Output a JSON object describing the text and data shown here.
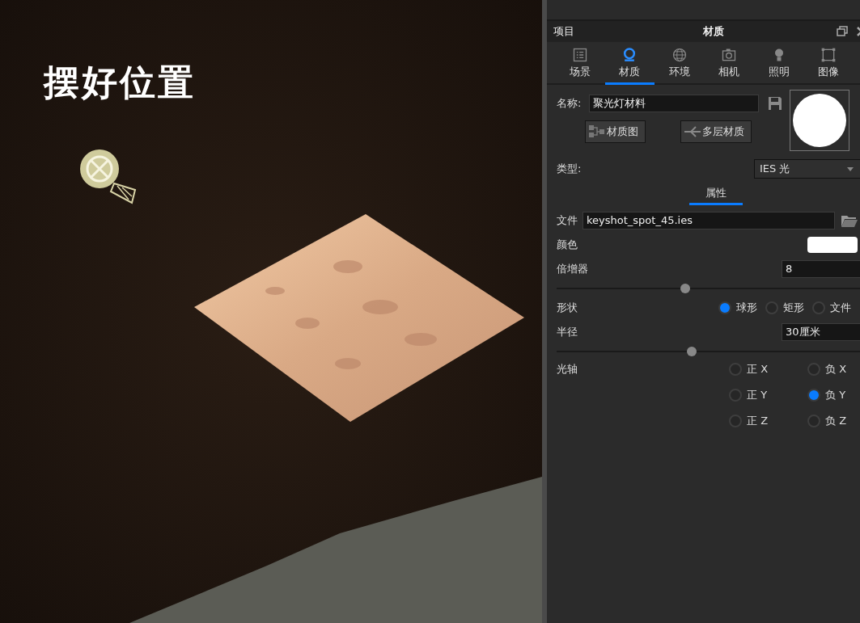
{
  "viewport": {
    "caption": "摆好位置"
  },
  "panel": {
    "project_label": "项目",
    "title": "材质",
    "tabs": [
      {
        "label": "场景",
        "selected": false
      },
      {
        "label": "材质",
        "selected": true
      },
      {
        "label": "环境",
        "selected": false
      },
      {
        "label": "相机",
        "selected": false
      },
      {
        "label": "照明",
        "selected": false
      },
      {
        "label": "图像",
        "selected": false
      }
    ],
    "name_label": "名称:",
    "name_value": "聚光灯材料",
    "buttons": [
      "材质图",
      "多层材质"
    ],
    "type_label": "类型:",
    "type_value": "IES 光",
    "section_tabs": [
      {
        "label": "属性",
        "selected": true
      }
    ],
    "properties": [
      {
        "kind": "file",
        "label": "文件",
        "value": "keyshot_spot_45.ies"
      },
      {
        "kind": "color",
        "label": "颜色",
        "color": "#ffffff"
      },
      {
        "kind": "number",
        "label": "倍增器",
        "value": "8",
        "level": 0.41
      },
      {
        "kind": "radio",
        "label": "形状",
        "options": [
          {
            "label": "球形",
            "selected": true
          },
          {
            "label": "矩形",
            "selected": false
          },
          {
            "label": "文件",
            "selected": false
          }
        ]
      },
      {
        "kind": "number",
        "label": "半径",
        "value": "30厘米",
        "level": 0.43
      },
      {
        "kind": "axis",
        "label": "光轴",
        "options": [
          {
            "label": "正 X",
            "selected": false
          },
          {
            "label": "负 X",
            "selected": false
          },
          {
            "label": "正 Y",
            "selected": false
          },
          {
            "label": "负 Y",
            "selected": true
          },
          {
            "label": "正 Z",
            "selected": false
          },
          {
            "label": "负 Z",
            "selected": false
          }
        ]
      }
    ]
  }
}
